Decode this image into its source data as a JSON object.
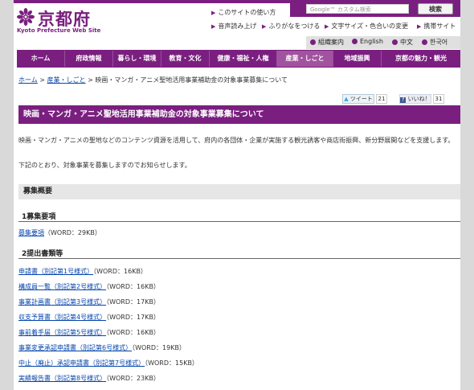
{
  "header": {
    "logo_text": "京都府",
    "logo_subtitle": "Kyoto Prefecture Web Site",
    "site_usage": "このサイトの使い方",
    "search_placeholder": "Google™ カスタム検索",
    "search_button": "検索",
    "utility_links": [
      "音声読み上げ",
      "ふりがなをつける",
      "文字サイズ・色合いの変更",
      "携帯サイト"
    ],
    "languages": [
      "組織案内",
      "English",
      "中文",
      "한국어"
    ]
  },
  "nav": {
    "items": [
      "ホーム",
      "府政情報",
      "暮らし・環境",
      "教育・文化",
      "健康・福祉・人権",
      "産業・しごと",
      "地域振興",
      "京都の魅力・観光"
    ],
    "active_index": 5
  },
  "breadcrumb": {
    "home": "ホーム",
    "sep1": " > ",
    "category": "産業・しごと",
    "sep2": " > ",
    "current": "映画・マンガ・アニメ聖地活用事業補助金の対象事業募集について"
  },
  "social": {
    "tweet_label": "ツイート",
    "tweet_count": "21",
    "like_label": "いいね！",
    "like_count": "31"
  },
  "main": {
    "title": "映画・マンガ・アニメ聖地活用事業補助金の対象事業募集について",
    "intro": "映画・マンガ・アニメの聖地などのコンテンツ資源を活用して、府内の各団体・企業が実施する観光誘客や商店街振興、新分野展開などを支援します。",
    "notice": "下記のとおり、対象事業を募集しますのでお知らせします。",
    "section_title": "募集概要",
    "sub1_title": "1募集要項",
    "sub1_docs": [
      {
        "link": "募集要項",
        "info": "（WORD：29KB）"
      }
    ],
    "sub2_title": "2提出書類等",
    "sub2_docs": [
      {
        "link": "申請書（別記第1号様式）",
        "info": "（WORD：16KB）"
      },
      {
        "link": "構成員一覧（別記第2号様式）",
        "info": "（WORD：16KB）"
      },
      {
        "link": "事業計画書（別記第3号様式）",
        "info": "（WORD：17KB）"
      },
      {
        "link": "収支予算書（別記第4号様式）",
        "info": "（WORD：17KB）"
      },
      {
        "link": "事前着手届（別記第5号様式）",
        "info": "（WORD：16KB）"
      },
      {
        "link": "事業変更承認申請書（別記第6号様式）",
        "info": "（WORD：19KB）"
      },
      {
        "link": "中止（廃止）承認申請書（別記第7号様式）",
        "info": "（WORD：15KB）"
      },
      {
        "link": "実績報告書（別記第8号様式）",
        "info": "（WORD：23KB）"
      }
    ]
  },
  "colors": {
    "brand": "#7a1f7f",
    "nav_active": "#a2539f",
    "link": "#0645ad"
  }
}
